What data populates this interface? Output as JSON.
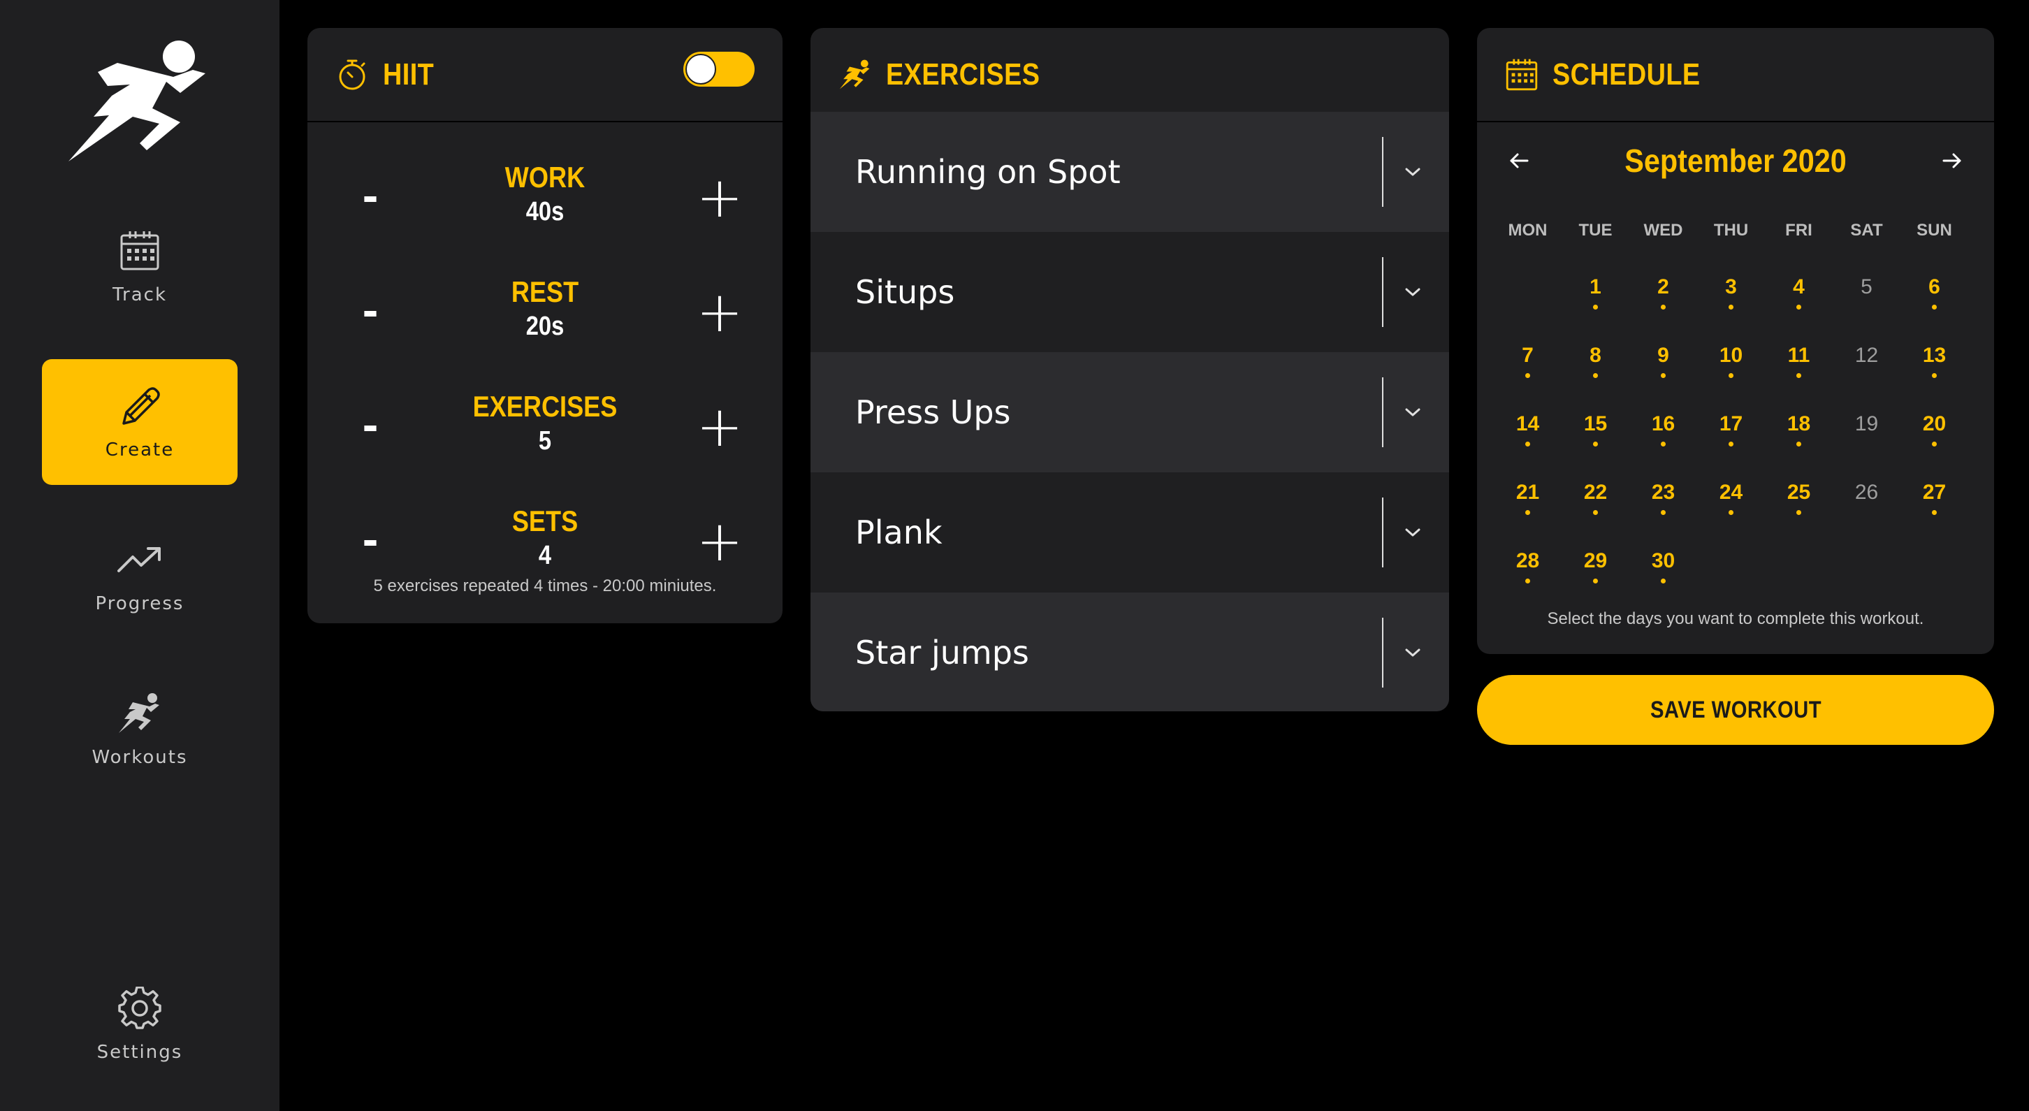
{
  "sidebar": {
    "logo_icon": "running-figure-logo",
    "items": [
      {
        "label": "Track",
        "icon": "calendar-icon",
        "active": false
      },
      {
        "label": "Create",
        "icon": "pencil-icon",
        "active": true
      },
      {
        "label": "Progress",
        "icon": "trending-up-icon",
        "active": false
      },
      {
        "label": "Workouts",
        "icon": "runner-icon",
        "active": false
      },
      {
        "label": "Settings",
        "icon": "gear-icon",
        "active": false
      }
    ]
  },
  "hiit": {
    "title": "HIIT",
    "icon": "stopwatch-icon",
    "toggle_on": true,
    "minus_label": "-",
    "plus_label": "+",
    "rows": [
      {
        "label": "WORK",
        "value": "40s"
      },
      {
        "label": "REST",
        "value": "20s"
      },
      {
        "label": "EXERCISES",
        "value": "5"
      },
      {
        "label": "SETS",
        "value": "4"
      }
    ],
    "summary": "5 exercises repeated 4 times - 20:00 miniutes."
  },
  "exercises": {
    "title": "EXERCISES",
    "icon": "runner-icon",
    "items": [
      {
        "name": "Running on Spot"
      },
      {
        "name": "Situps"
      },
      {
        "name": "Press Ups"
      },
      {
        "name": "Plank"
      },
      {
        "name": "Star jumps"
      }
    ]
  },
  "schedule": {
    "title": "SCHEDULE",
    "icon": "calendar-icon",
    "month": "September 2020",
    "prev_icon": "arrow-left-icon",
    "next_icon": "arrow-right-icon",
    "weekdays": [
      "MON",
      "TUE",
      "WED",
      "THU",
      "FRI",
      "SAT",
      "SUN"
    ],
    "days": [
      {
        "day": "1",
        "selected": true
      },
      {
        "day": "2",
        "selected": true
      },
      {
        "day": "3",
        "selected": true
      },
      {
        "day": "4",
        "selected": true
      },
      {
        "day": "5",
        "selected": false
      },
      {
        "day": "6",
        "selected": true
      },
      {
        "day": "7",
        "selected": true
      },
      {
        "day": "8",
        "selected": true
      },
      {
        "day": "9",
        "selected": true
      },
      {
        "day": "10",
        "selected": true
      },
      {
        "day": "11",
        "selected": true
      },
      {
        "day": "12",
        "selected": false
      },
      {
        "day": "13",
        "selected": true
      },
      {
        "day": "14",
        "selected": true
      },
      {
        "day": "15",
        "selected": true
      },
      {
        "day": "16",
        "selected": true
      },
      {
        "day": "17",
        "selected": true
      },
      {
        "day": "18",
        "selected": true
      },
      {
        "day": "19",
        "selected": false
      },
      {
        "day": "20",
        "selected": true
      },
      {
        "day": "21",
        "selected": true
      },
      {
        "day": "22",
        "selected": true
      },
      {
        "day": "23",
        "selected": true
      },
      {
        "day": "24",
        "selected": true
      },
      {
        "day": "25",
        "selected": true
      },
      {
        "day": "26",
        "selected": false
      },
      {
        "day": "27",
        "selected": true
      },
      {
        "day": "28",
        "selected": true
      },
      {
        "day": "29",
        "selected": true
      },
      {
        "day": "30",
        "selected": true
      }
    ],
    "note": "Select the days you want to complete this workout."
  },
  "save_button": {
    "label": "SAVE WORKOUT"
  },
  "colors": {
    "accent": "#ffc000",
    "panel": "#1f1f21",
    "panel_light": "#2c2c2f",
    "background": "#000000"
  }
}
